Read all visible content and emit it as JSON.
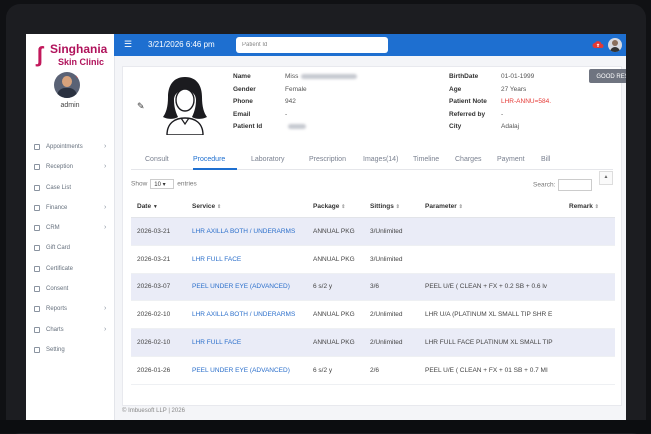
{
  "brand": {
    "name": "Singhania",
    "subtitle": "Skin Clinic",
    "accent": "#b0125b"
  },
  "user": {
    "role": "admin"
  },
  "topbar": {
    "datetime": "3/21/2026 6:46 pm",
    "search_placeholder": "Patient Id",
    "color": "#1e6fd0"
  },
  "sidebar": {
    "items": [
      {
        "label": "Appointments",
        "icon": "calendar-icon",
        "chevron": "›"
      },
      {
        "label": "Reception",
        "icon": "plus-icon",
        "chevron": "›"
      },
      {
        "label": "Case List",
        "icon": "users-icon",
        "chevron": ""
      },
      {
        "label": "Finance",
        "icon": "rupee-icon",
        "chevron": "›"
      },
      {
        "label": "CRM",
        "icon": "crm-icon",
        "chevron": "›"
      },
      {
        "label": "Gift Card",
        "icon": "gift-card-icon",
        "chevron": ""
      },
      {
        "label": "Certificate",
        "icon": "certificate-icon",
        "chevron": ""
      },
      {
        "label": "Consent",
        "icon": "consent-icon",
        "chevron": ""
      },
      {
        "label": "Reports",
        "icon": "reports-icon",
        "chevron": "›"
      },
      {
        "label": "Charts",
        "icon": "charts-icon",
        "chevron": "›"
      },
      {
        "label": "Setting",
        "icon": "settings-icon",
        "chevron": ""
      }
    ]
  },
  "patient": {
    "left": [
      {
        "key": "Name",
        "value": "Miss"
      },
      {
        "key": "Gender",
        "value": "Female"
      },
      {
        "key": "Phone",
        "value": "942"
      },
      {
        "key": "Email",
        "value": "-"
      },
      {
        "key": "Patient Id",
        "value": ""
      }
    ],
    "right": [
      {
        "key": "BirthDate",
        "value": "01-01-1999"
      },
      {
        "key": "Age",
        "value": "27 Years"
      },
      {
        "key": "Patient Note",
        "value": "LHR-ANNU=584."
      },
      {
        "key": "Referred by",
        "value": "-"
      },
      {
        "key": "City",
        "value": "Adalaj"
      }
    ],
    "good_result_label": "GOOD RESULT"
  },
  "tabs": [
    "Consult",
    "Procedure",
    "Laboratory",
    "Prescription",
    "Images(14)",
    "Timeline",
    "Charges",
    "Payment",
    "Bill"
  ],
  "active_tab": "Procedure",
  "table_controls": {
    "show_label": "Show",
    "show_value": "10",
    "entries_label": "entries",
    "search_label": "Search:"
  },
  "table": {
    "headers": [
      "Date",
      "Service",
      "Package",
      "Sittings",
      "Parameter",
      "Remark"
    ],
    "rows": [
      [
        "2026-03-21",
        "LHR AXILLA BOTH / UNDERARMS",
        "ANNUAL PKG",
        "3/Unlimited",
        "",
        ""
      ],
      [
        "2026-03-21",
        "LHR FULL FACE",
        "ANNUAL PKG",
        "3/Unlimited",
        "",
        ""
      ],
      [
        "2026-03-07",
        "PEEL UNDER EYE (ADVANCED)",
        "6 s/2 y",
        "3/6",
        "PEEL U/E ( CLEAN + FX + 0.2 SB + 0.6 lv",
        ""
      ],
      [
        "2026-02-10",
        "LHR AXILLA BOTH / UNDERARMS",
        "ANNUAL PKG",
        "2/Unlimited",
        "LHR U/A (PLATINUM XL SMALL TIP SHR E",
        ""
      ],
      [
        "2026-02-10",
        "LHR FULL FACE",
        "ANNUAL PKG",
        "2/Unlimited",
        "LHR FULL FACE PLATINUM XL SMALL TIP",
        ""
      ],
      [
        "2026-01-26",
        "PEEL UNDER EYE (ADVANCED)",
        "6 s/2 y",
        "2/6",
        "PEEL U/E ( CLEAN + FX + 01 SB + 0.7 MI",
        ""
      ]
    ]
  },
  "footer": "© Imbuesoft LLP | 2026"
}
